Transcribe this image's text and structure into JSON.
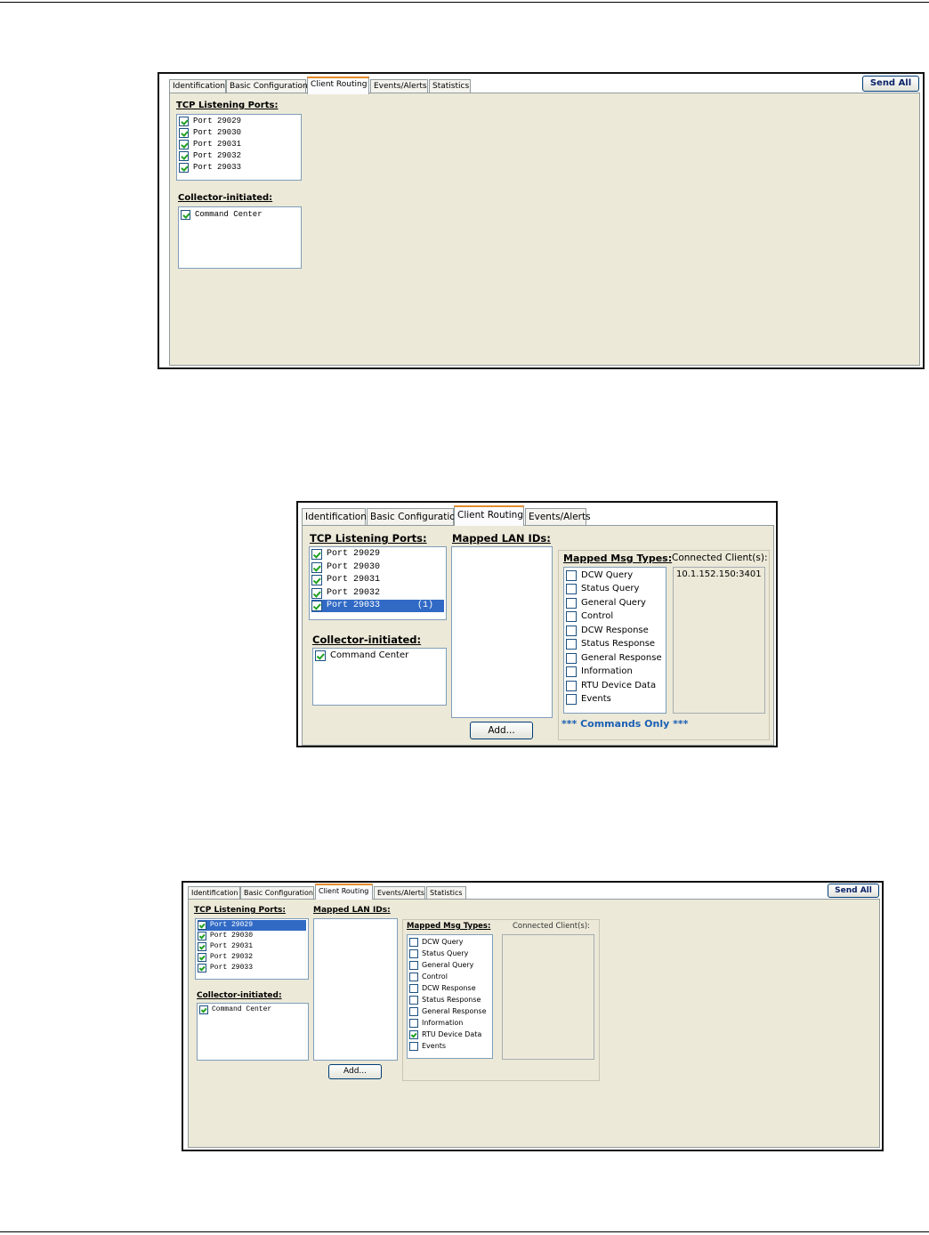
{
  "screenshot1": {
    "tabs": [
      "Identification",
      "Basic Configuration",
      "Client Routing",
      "Events/Alerts",
      "Statistics"
    ],
    "send_all": "Send All",
    "tcp_label": "TCP Listening Ports:",
    "ports": [
      "Port 29029",
      "Port 29030",
      "Port 29031",
      "Port 29032",
      "Port 29033"
    ],
    "collector_label": "Collector-initiated:",
    "collector_items": [
      "Command Center"
    ]
  },
  "screenshot2": {
    "tabs": [
      "Identification",
      "Basic Configuration",
      "Client Routing",
      "Events/Alerts"
    ],
    "tcp_label": "TCP Listening Ports:",
    "ports": [
      "Port 29029",
      "Port 29030",
      "Port 29031",
      "Port 29032",
      "Port 29033       (1)"
    ],
    "mapped_lan_label": "Mapped LAN IDs:",
    "collector_label": "Collector-initiated:",
    "collector_items": [
      "Command Center"
    ],
    "add_button": "Add...",
    "msg_types_label": "Mapped Msg Types:",
    "msg_types": [
      "DCW Query",
      "Status Query",
      "General Query",
      "Control",
      "DCW Response",
      "Status Response",
      "General Response",
      "Information",
      "RTU Device Data",
      "Events"
    ],
    "connected_label": "Connected Client(s):",
    "connected_clients": [
      "10.1.152.150:3401"
    ],
    "commands_note": "*** Commands Only ***"
  },
  "screenshot3": {
    "tabs": [
      "Identification",
      "Basic Configuration",
      "Client Routing",
      "Events/Alerts",
      "Statistics"
    ],
    "send_all": "Send All",
    "tcp_label": "TCP Listening Ports:",
    "ports": [
      "Port 29029",
      "Port 29030",
      "Port 29031",
      "Port 29032",
      "Port 29033"
    ],
    "mapped_lan_label": "Mapped LAN IDs:",
    "collector_label": "Collector-initiated:",
    "collector_items": [
      "Command Center"
    ],
    "add_button": "Add...",
    "msg_types_label": "Mapped Msg Types:",
    "msg_types": [
      "DCW Query",
      "Status Query",
      "General Query",
      "Control",
      "DCW Response",
      "Status Response",
      "General Response",
      "Information",
      "RTU Device Data",
      "Events"
    ],
    "connected_label": "Connected Client(s):"
  }
}
